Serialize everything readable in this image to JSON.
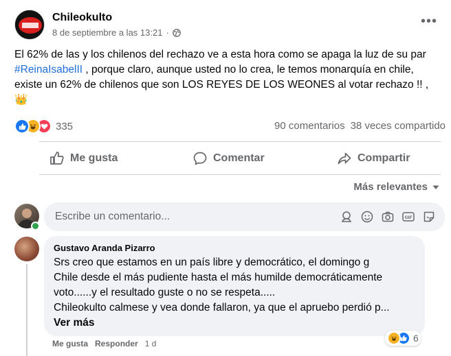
{
  "post": {
    "page_name": "Chileokulto",
    "date": "8 de septiembre a las 13:21",
    "privacy_icon": "globe-icon",
    "text_part1": "El 62% de las y los chilenos del rechazo ve a esta hora como se apaga la luz de su par ",
    "hashtag": "#ReinaIsabelII",
    "text_part2": " , porque claro, aunque usted no lo crea, le temos monarquía en chile, existe un 62% de chilenos que son LOS REYES DE LOS WEONES al votar rechazo !! ,",
    "emoji": "👑",
    "reaction_count": "335",
    "comments_count": "90 comentarios",
    "shares_count": "38 veces compartido"
  },
  "actions": {
    "like": "Me gusta",
    "comment": "Comentar",
    "share": "Compartir"
  },
  "comments_section": {
    "sort_label": "Más relevantes",
    "composer_placeholder": "Escribe un comentario..."
  },
  "comment": {
    "author": "Gustavo Aranda Pizarro",
    "line1": "Srs creo que estamos en un país libre y democrático, el domingo g",
    "line2": "Chile desde el más pudiente hasta el más humilde democráticamente",
    "line3": "voto......y el resultado guste o no se respeta.....",
    "line4": "Chileokulto calmese y vea donde fallaron, ya que el apruebo perdió p...",
    "see_more": "Ver más",
    "like": "Me gusta",
    "reply": "Responder",
    "time": "1 d",
    "reaction_count": "6"
  },
  "colors": {
    "like_blue": "#1877f2",
    "love_red": "#f33e58",
    "haha_yellow": "#f7b125",
    "hashtag_blue": "#216fdb",
    "muted_text": "#65676b"
  }
}
